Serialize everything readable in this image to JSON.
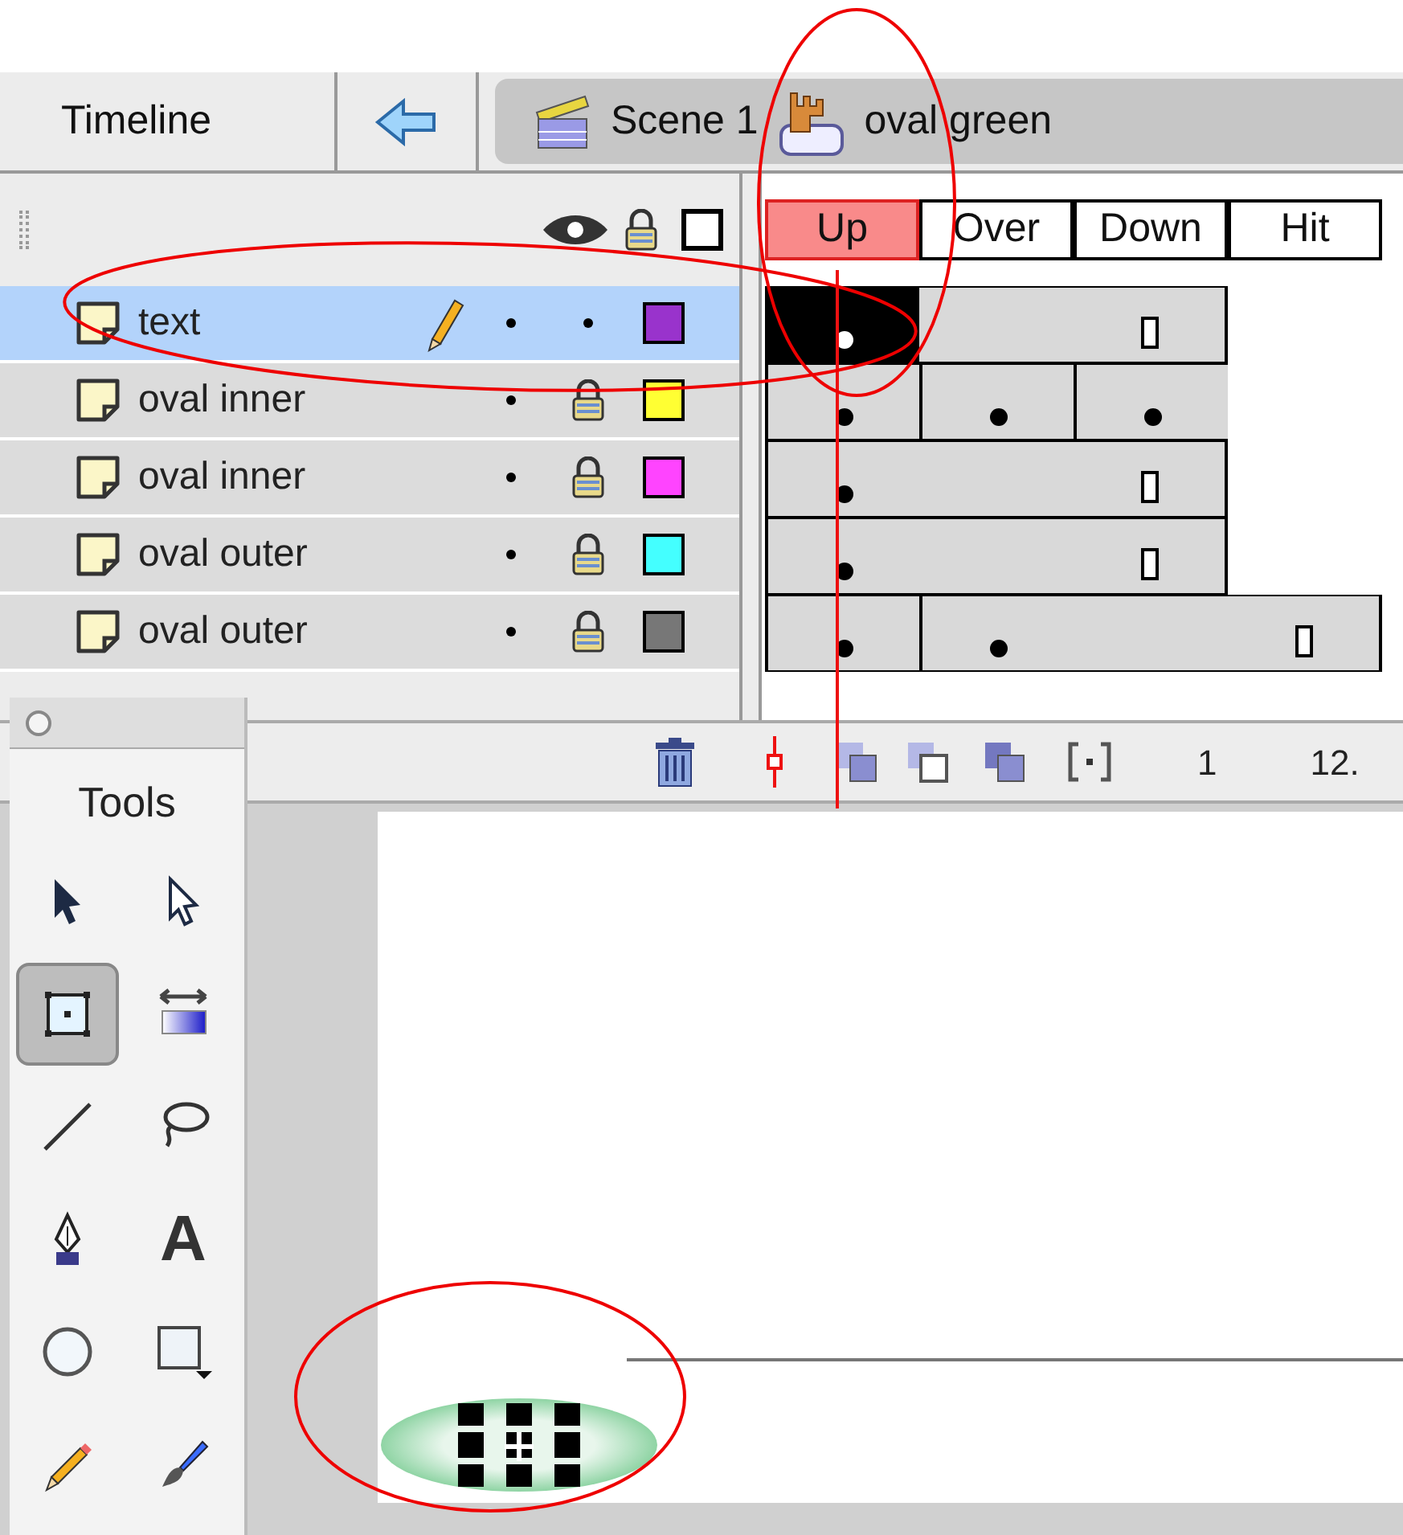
{
  "header": {
    "panel_tab": "Timeline",
    "breadcrumb": [
      {
        "kind": "scene",
        "label": "Scene 1"
      },
      {
        "kind": "symbol",
        "label": "oval green"
      }
    ]
  },
  "frame_labels": [
    {
      "label": "Up",
      "selected": true
    },
    {
      "label": "Over",
      "selected": false
    },
    {
      "label": "Down",
      "selected": false
    },
    {
      "label": "Hit",
      "selected": false
    }
  ],
  "layers": [
    {
      "name": "text",
      "selected": true,
      "editing": true,
      "locked": false,
      "color": "#9933cc",
      "frames": [
        {
          "kind": "keyframe",
          "selected": true
        },
        {
          "kind": "hold",
          "selected": false
        },
        {
          "kind": "end",
          "selected": false
        },
        {
          "kind": "none"
        }
      ]
    },
    {
      "name": "oval inner",
      "selected": false,
      "editing": false,
      "locked": true,
      "color": "#ffff33",
      "frames": [
        {
          "kind": "keyframe",
          "selected": false
        },
        {
          "kind": "keyframe",
          "selected": false
        },
        {
          "kind": "keyframe",
          "selected": false
        },
        {
          "kind": "none"
        }
      ]
    },
    {
      "name": "oval inner",
      "selected": false,
      "editing": false,
      "locked": true,
      "color": "#ff44ff",
      "frames": [
        {
          "kind": "keyframe",
          "selected": false
        },
        {
          "kind": "hold",
          "selected": false
        },
        {
          "kind": "end",
          "selected": false
        },
        {
          "kind": "none"
        }
      ]
    },
    {
      "name": "oval outer",
      "selected": false,
      "editing": false,
      "locked": true,
      "color": "#44ffff",
      "frames": [
        {
          "kind": "keyframe",
          "selected": false
        },
        {
          "kind": "hold",
          "selected": false
        },
        {
          "kind": "end",
          "selected": false
        },
        {
          "kind": "none"
        }
      ]
    },
    {
      "name": "oval outer",
      "selected": false,
      "editing": false,
      "locked": true,
      "color": "#777777",
      "frames": [
        {
          "kind": "keyframe",
          "selected": false
        },
        {
          "kind": "keyframe",
          "selected": false
        },
        {
          "kind": "hold",
          "selected": false
        },
        {
          "kind": "end",
          "selected": false
        }
      ]
    }
  ],
  "status": {
    "current_frame": "1",
    "frame_rate": "12."
  },
  "tools": {
    "title": "Tools",
    "items": [
      {
        "kind": "arrow",
        "selected": false
      },
      {
        "kind": "subselect",
        "selected": false
      },
      {
        "kind": "free-transform",
        "selected": true
      },
      {
        "kind": "fill-transform",
        "selected": false
      },
      {
        "kind": "line",
        "selected": false
      },
      {
        "kind": "lasso",
        "selected": false
      },
      {
        "kind": "pen",
        "selected": false
      },
      {
        "kind": "text",
        "label": "A",
        "selected": false
      },
      {
        "kind": "oval",
        "selected": false
      },
      {
        "kind": "rectangle",
        "selected": false
      },
      {
        "kind": "pencil",
        "selected": false
      },
      {
        "kind": "brush",
        "selected": false
      }
    ]
  }
}
